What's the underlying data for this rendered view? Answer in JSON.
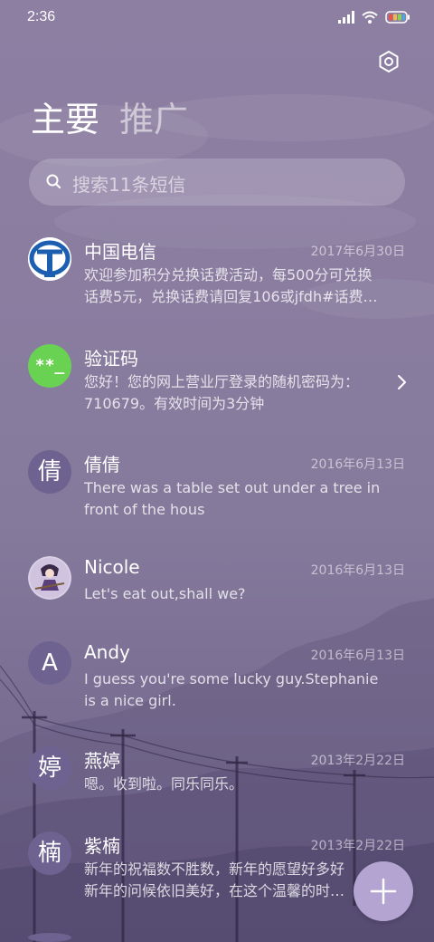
{
  "status_bar": {
    "time": "2:36",
    "icons": [
      "signal-icon",
      "wifi-icon",
      "battery-icon"
    ]
  },
  "header": {
    "settings_icon": "gear-icon",
    "tabs": [
      {
        "label": "主要",
        "active": true
      },
      {
        "label": "推广",
        "active": false
      }
    ]
  },
  "search": {
    "placeholder": "搜索11条短信"
  },
  "conversations": [
    {
      "name": "中国电信",
      "date": "2017年6月30日",
      "snippet": "欢迎参加积分兑换话费活动，每500分可兑换\n话费5元，兑换话费请回复106或jfdh#话费…",
      "avatar": "china-telecom-logo"
    },
    {
      "name": "验证码",
      "date": "",
      "snippet": "您好！您的网上营业厅登录的随机密码为：\n710679。有效时间为3分钟",
      "avatar": "verification-code-icon",
      "avatar_text": "**_"
    },
    {
      "name": "倩倩",
      "date": "2016年6月13日",
      "snippet": "There was a table set out under a tree in\nfront of the hous",
      "avatar_text": "倩"
    },
    {
      "name": "Nicole",
      "date": "2016年6月13日",
      "snippet": "Let's eat out,shall we?",
      "avatar": "photo-avatar"
    },
    {
      "name": "Andy",
      "date": "2016年6月13日",
      "snippet": "I guess you're some lucky guy.Stephanie\nis a nice girl.",
      "avatar_text": "A"
    },
    {
      "name": "燕婷",
      "date": "2013年2月22日",
      "snippet": "嗯。收到啦。同乐同乐。",
      "avatar_text": "婷"
    },
    {
      "name": "紫楠",
      "date": "2013年2月22日",
      "snippet": "新年的祝福数不胜数，新年的愿望好多好\n新年的问候依旧美好，在这个温馨的时…",
      "avatar_text": "楠"
    }
  ],
  "fab": {
    "icon": "plus-icon"
  },
  "colors": {
    "background": "#8a7da0",
    "avatar": "#6e6390",
    "verification_avatar": "#6ad252",
    "fab": "#b3a4d2",
    "telecom_blue": "#1c5fb0"
  }
}
